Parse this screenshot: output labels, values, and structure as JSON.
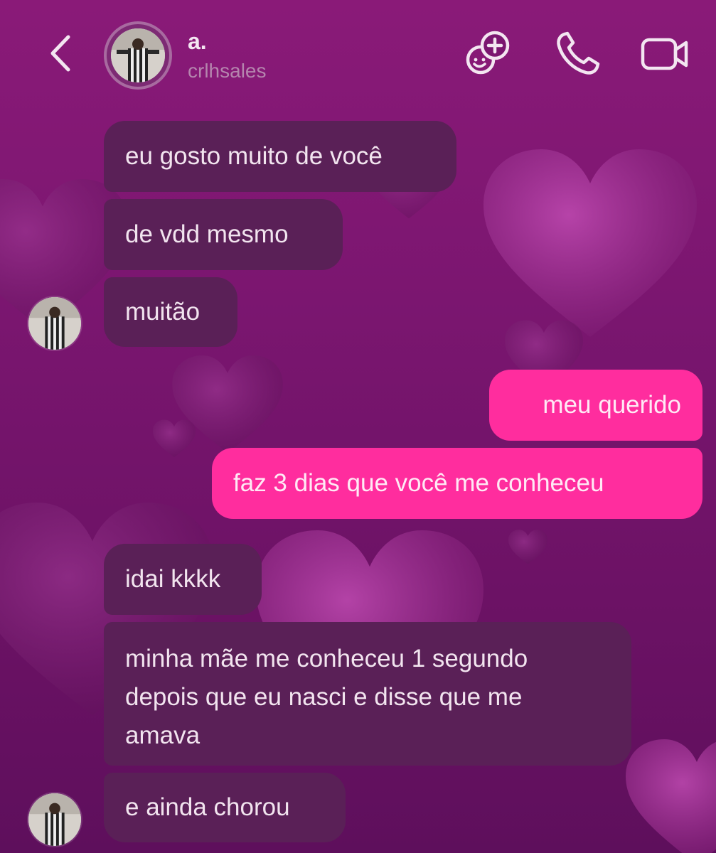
{
  "header": {
    "title": "a.",
    "subtitle": "crlhsales",
    "icons": [
      "back-chevron-icon",
      "add-friend-sticker-icon",
      "phone-icon",
      "video-camera-icon"
    ]
  },
  "messages": [
    {
      "direction": "received",
      "text": "eu gosto muito de você"
    },
    {
      "direction": "received",
      "text": "de vdd mesmo"
    },
    {
      "direction": "received",
      "text": "muitão"
    },
    {
      "direction": "sent",
      "text": "meu querido"
    },
    {
      "direction": "sent",
      "text": "faz 3 dias que você me conheceu"
    },
    {
      "direction": "received",
      "text": "idai kkkk"
    },
    {
      "direction": "received",
      "lines": [
        "minha mãe me conheceu 1 segundo",
        "depois que eu nasci e disse que me",
        "amava"
      ]
    },
    {
      "direction": "received",
      "text": "e ainda chorou"
    }
  ],
  "colors": {
    "background": "#7b1670",
    "received_bubble": "#5a2057",
    "sent_bubble": "#ff2d9e",
    "text": "#f2e4ef"
  }
}
